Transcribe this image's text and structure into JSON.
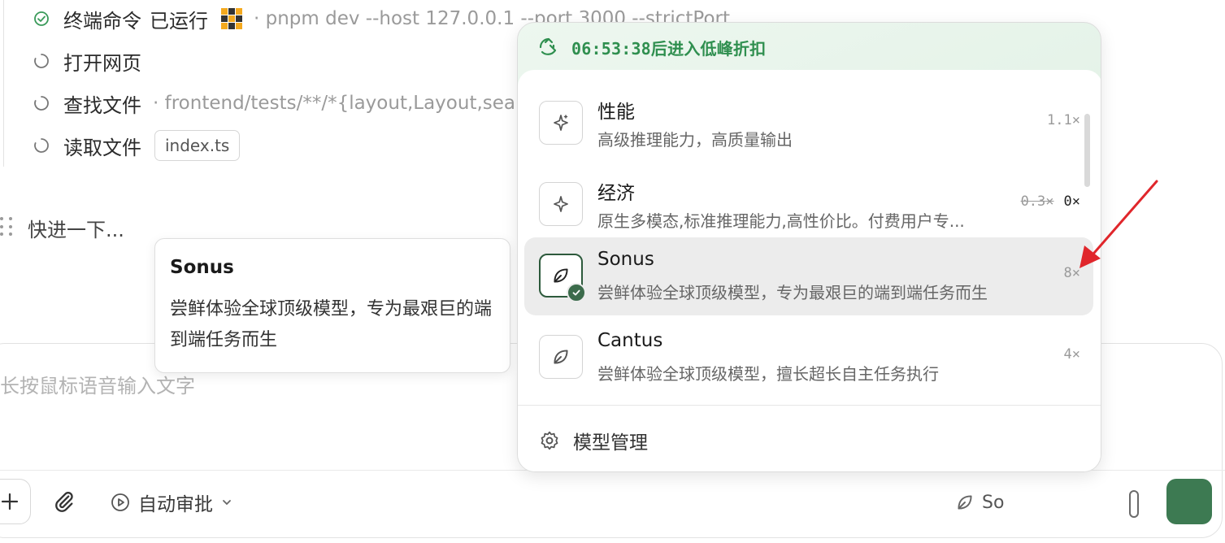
{
  "task_log": {
    "items": [
      {
        "label": "终端命令",
        "status": "已运行",
        "detail": "· pnpm dev --host 127.0.0.1 --port 3000 --strictPort",
        "state": "done"
      },
      {
        "label": "打开网页",
        "state": "pending"
      },
      {
        "label": "查找文件",
        "detail": "· frontend/tests/**/*{layout,Layout,search",
        "state": "pending"
      },
      {
        "label": "读取文件",
        "chip": "index.ts",
        "state": "pending"
      }
    ],
    "quick_text": "快进一下..."
  },
  "tooltip": {
    "title": "Sonus",
    "body": "尝鲜体验全球顶级模型，专为最艰巨的端到端任务而生"
  },
  "composer": {
    "placeholder": "长按鼠标语音输入文字",
    "auto_approve_label": "自动审批",
    "model_label": "So"
  },
  "model_menu": {
    "promo": "06:53:38后进入低峰折扣",
    "models": [
      {
        "name": "性能",
        "desc": "高级推理能力，高质量输出",
        "multiplier": "1.1×",
        "icon": "sparkle-icon"
      },
      {
        "name": "经济",
        "desc": "原生多模态,标准推理能力,高性价比。付费用户专...",
        "multiplier_old": "0.3×",
        "multiplier": "0×",
        "icon": "sparkle-icon"
      },
      {
        "name": "Sonus",
        "desc": "尝鲜体验全球顶级模型，专为最艰巨的端到端任务而生",
        "multiplier": "8×",
        "icon": "leaf-icon",
        "selected": true
      },
      {
        "name": "Cantus",
        "desc": "尝鲜体验全球顶级模型，擅长超长自主任务执行",
        "multiplier": "4×",
        "icon": "leaf-icon"
      }
    ],
    "manage_label": "模型管理"
  },
  "colors": {
    "accent_green": "#2f8f4f",
    "send_button": "#3d7a52",
    "annotation_red": "#e0262b"
  }
}
